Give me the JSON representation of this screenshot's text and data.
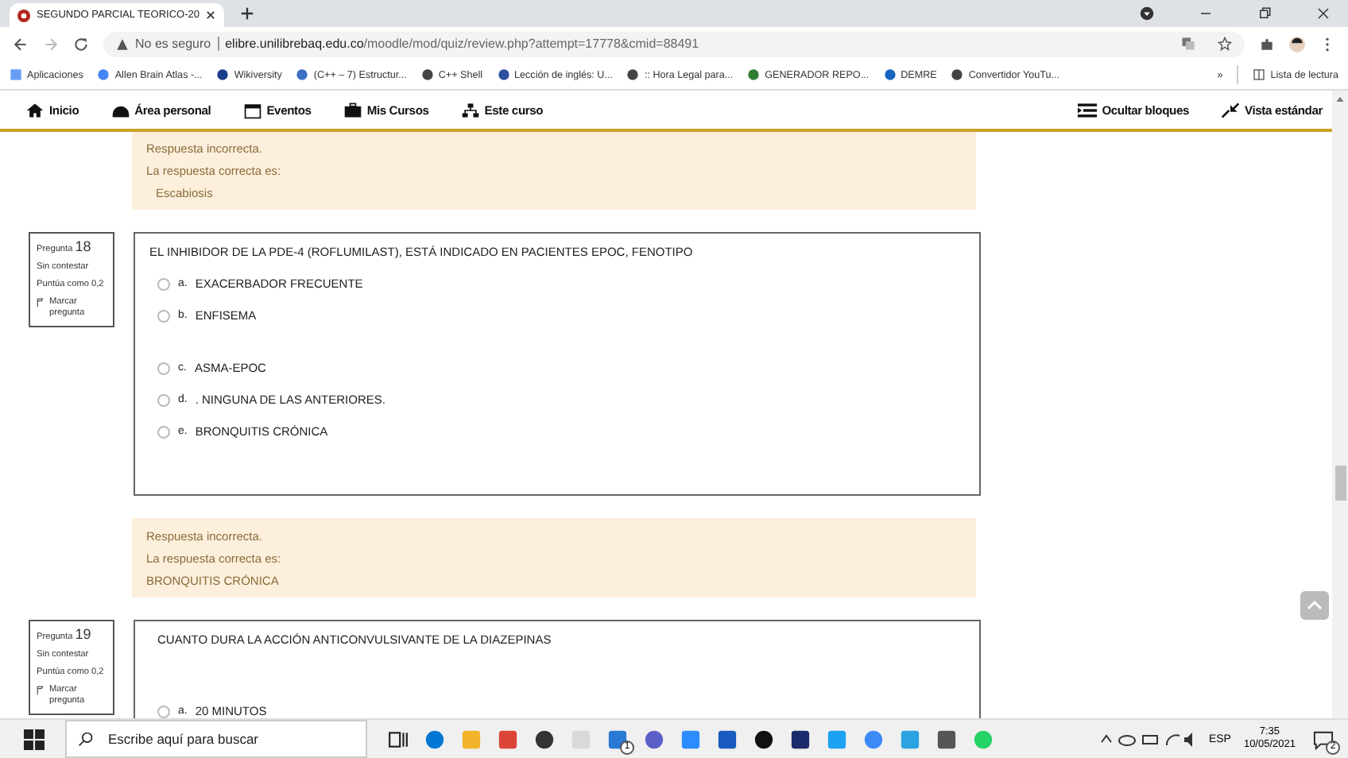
{
  "browser": {
    "tab_title": "SEGUNDO PARCIAL TEORICO-20",
    "security": "No es seguro",
    "url_host": "elibre.unilibrebaq.edu.co",
    "url_path": "/moodle/mod/quiz/review.php?attempt=17778&cmid=88491",
    "bookmarks": [
      "Aplicaciones",
      "Allen Brain Atlas -...",
      "Wikiversity",
      "(C++ – 7) Estructur...",
      "C++ Shell",
      "Lección de inglés: U...",
      ":: Hora Legal para...",
      "GENERADOR REPO...",
      "DEMRE",
      "Convertidor YouTu..."
    ],
    "more": "»",
    "reading_list": "Lista de lectura"
  },
  "nav": {
    "left": [
      "Inicio",
      "Área personal",
      "Eventos",
      "Mis Cursos",
      "Este curso"
    ],
    "right": [
      "Ocultar bloques",
      "Vista estándar"
    ]
  },
  "blocks": [
    {
      "kind": "feedback",
      "status": "Respuesta incorrecta.",
      "label": "La respuesta correcta es:",
      "answer": "Escabiosis"
    },
    {
      "kind": "question",
      "prefix": "Pregunta",
      "number": "18",
      "state": "Sin contestar",
      "grade": "Puntúa como 0,2",
      "flag": "Marcar pregunta",
      "text": "EL INHIBIDOR DE LA PDE-4 (ROFLUMILAST), ESTÁ INDICADO EN PACIENTES EPOC, FENOTIPO",
      "options": [
        {
          "letter": "a.",
          "text": "EXACERBADOR FRECUENTE",
          "selected": false
        },
        {
          "letter": "b.",
          "text": "ENFISEMA",
          "selected": false
        },
        {
          "letter": "c.",
          "text": "ASMA-EPOC",
          "selected": false
        },
        {
          "letter": "d.",
          "text": ". NINGUNA DE LAS ANTERIORES.",
          "selected": false
        },
        {
          "letter": "e.",
          "text": "BRONQUITIS CRÓNICA",
          "selected": false
        }
      ]
    },
    {
      "kind": "feedback",
      "status": "Respuesta incorrecta.",
      "label": "La respuesta correcta es:",
      "answer": "BRONQUITIS CRÓNICA"
    },
    {
      "kind": "question",
      "prefix": "Pregunta",
      "number": "19",
      "state": "Sin contestar",
      "grade": "Puntúa como 0,2",
      "flag": "Marcar pregunta",
      "text": "CUANTO DURA LA ACCIÓN ANTICONVULSIVANTE DE LA DIAZEPINAS",
      "options": [
        {
          "letter": "a.",
          "text": "20 MINUTOS",
          "selected": false
        }
      ]
    }
  ],
  "taskbar": {
    "search_placeholder": "Escribe aquí para buscar",
    "mail_badge": "1",
    "language": "ESP",
    "time": "7:35",
    "date": "10/05/2021",
    "notifications": "2"
  }
}
